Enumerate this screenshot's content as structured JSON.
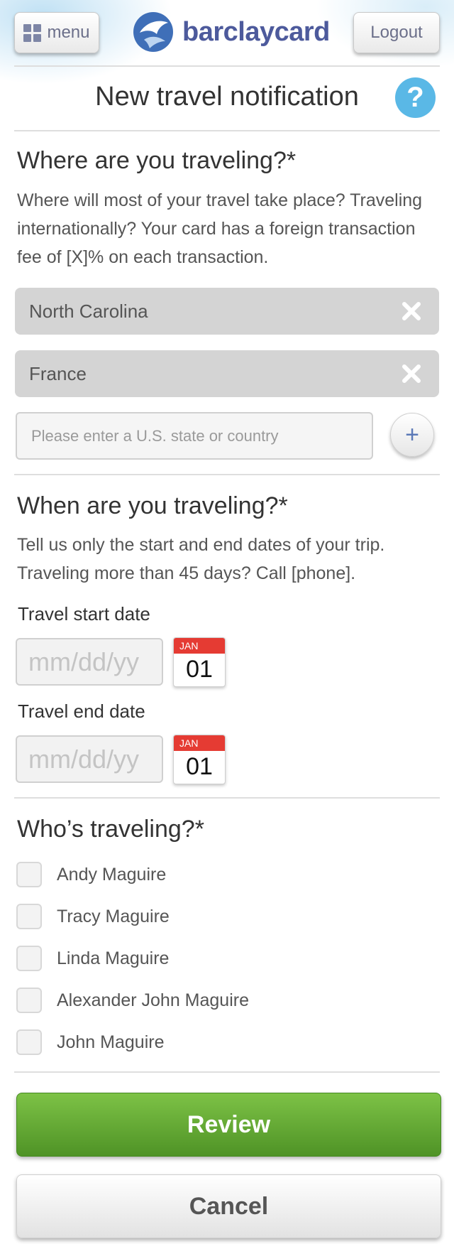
{
  "header": {
    "menu_label": "menu",
    "logo_text": "barclaycard",
    "logout_label": "Logout",
    "page_title": "New travel notification",
    "help_label": "?"
  },
  "where": {
    "title": "Where are you traveling?*",
    "description": "Where will most of your travel take place? Traveling internationally? Your card has a foreign transaction fee of [X]% on each transaction.",
    "locations": [
      "North Carolina",
      "France"
    ],
    "input_placeholder": "Please enter a U.S. state or country",
    "input_value": "",
    "add_label": "+"
  },
  "when": {
    "title": "When are you traveling?*",
    "description": "Tell us only the start and end dates of your trip. Traveling more than 45 days? Call [phone].",
    "start_label": "Travel start date",
    "end_label": "Travel end date",
    "date_placeholder": "mm/dd/yy",
    "calendar_month": "JAN",
    "calendar_day": "01"
  },
  "who": {
    "title": "Who’s traveling?*",
    "travelers": [
      "Andy Maguire",
      "Tracy Maguire",
      "Linda Maguire",
      "Alexander John Maguire",
      "John Maguire"
    ]
  },
  "actions": {
    "review_label": "Review",
    "cancel_label": "Cancel"
  },
  "colors": {
    "brand": "#4d5a9c",
    "help": "#5ab8e6",
    "review": "#66ad36",
    "calendar_red": "#e53b33"
  }
}
